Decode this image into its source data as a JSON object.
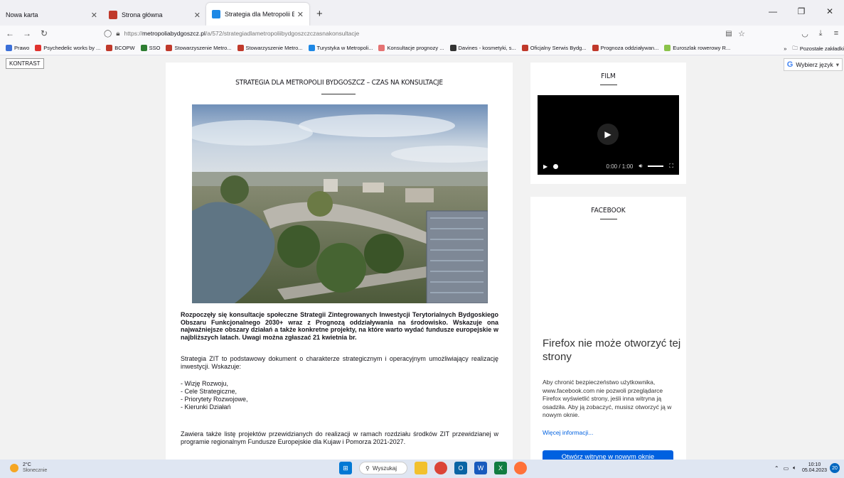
{
  "browser": {
    "tabs": [
      {
        "title": "Nowa karta",
        "active": false
      },
      {
        "title": "Strona główna",
        "active": false
      },
      {
        "title": "Strategia dla Metropolii Bydgo:",
        "active": true
      }
    ],
    "url_prefix": "https://",
    "url_domain": "metropoliabydgoszcz.pl",
    "url_path": "/a/572/strategiadlametropoliibydgoszczczasnakonsultacje",
    "bookmarks": [
      {
        "label": "Prawo",
        "color": "#3b6fd8"
      },
      {
        "label": "Psychedelic works by ...",
        "color": "#e0332f"
      },
      {
        "label": "BCOPW",
        "color": "#c0392b"
      },
      {
        "label": "SSO",
        "color": "#2e7d32"
      },
      {
        "label": "Stowarzyszenie Metro...",
        "color": "#c0392b"
      },
      {
        "label": "Stowarzyszenie Metro...",
        "color": "#c0392b"
      },
      {
        "label": "Turystyka w Metropoli...",
        "color": "#1e88e5"
      },
      {
        "label": "Konsultacje prognozy ...",
        "color": "#e57373"
      },
      {
        "label": "Davines - kosmetyki, s...",
        "color": "#333"
      },
      {
        "label": "Oficjalny Serwis Bydg...",
        "color": "#c0392b"
      },
      {
        "label": "Prognoza oddziaływan...",
        "color": "#c0392b"
      },
      {
        "label": "Euroszlak rowerowy R...",
        "color": "#8bc34a"
      }
    ],
    "bookmarks_overflow": "Pozostałe zakładki"
  },
  "page": {
    "kontrast_button": "KONTRAST",
    "translate_label": "Wybierz język",
    "article": {
      "title": "STRATEGIA DLA METROPOLII BYDGOSZCZ – CZAS NA KONSULTACJE",
      "lead": "Rozpoczęły się konsultacje społeczne Strategii Zintegrowanych Inwestycji Terytorialnych Bydgoskiego Obszaru Funkcjonalnego 2030+ wraz z Prognozą oddziaływania na środowisko. Wskazuje ona najważniejsze obszary działań a także konkretne projekty, na które warto wydać fundusze europejskie w najbliższych latach. Uwagi można zgłaszać 21 kwietnia br.",
      "p1": "Strategia ZIT to podstawowy dokument o charakterze strategicznym i operacyjnym umożliwiający realizację inwestycji. Wskazuje:",
      "list": [
        "- Wizję Rozwoju,",
        "- Cele Strategiczne,",
        "- Priorytety Rozwojowe,",
        "- Kierunki Działań"
      ],
      "p2": "Zawiera także listę projektów przewidzianych do realizacji w ramach rozdziału środków ZIT przewidzianej w programie regionalnym Fundusze Europejskie dla Kujaw i Pomorza 2021-2027."
    },
    "film": {
      "heading": "FILM",
      "time": "0:00 / 1:00"
    },
    "facebook": {
      "heading": "FACEBOOK",
      "error_title": "Firefox nie może otworzyć tej strony",
      "error_body": "Aby chronić bezpieczeństwo użytkownika, www.facebook.com nie pozwoli przeglądarce Firefox wyświetlić strony, jeśli inna witryna ją osadziła. Aby ją zobaczyć, musisz otworzyć ją w nowym oknie.",
      "more_link": "Więcej informacji...",
      "open_button": "Otwórz witrynę w nowym oknie"
    }
  },
  "taskbar": {
    "temperature": "2°C",
    "weather": "Słonecznie",
    "search": "Wyszukaj",
    "time": "10:10",
    "date": "05.04.2023",
    "notifications": "20"
  }
}
